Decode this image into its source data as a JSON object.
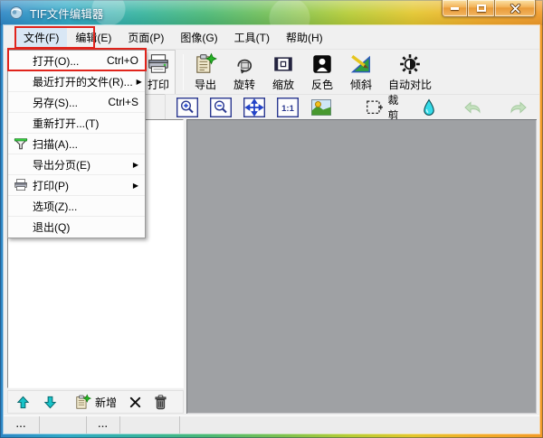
{
  "window": {
    "title": "TIF文件编辑器"
  },
  "window_controls": {
    "minimize": "minimize-icon",
    "maximize": "maximize-icon",
    "close": "close-icon"
  },
  "menubar": {
    "items": [
      {
        "label": "文件(F)",
        "annotated": true
      },
      {
        "label": "编辑(E)"
      },
      {
        "label": "页面(P)"
      },
      {
        "label": "图像(G)"
      },
      {
        "label": "工具(T)"
      },
      {
        "label": "帮助(H)"
      }
    ]
  },
  "file_menu": {
    "items": [
      {
        "label": "打开(O)...",
        "shortcut": "Ctrl+O",
        "annotated": true
      },
      {
        "label": "最近打开的文件(R)...",
        "submenu": true
      },
      {
        "label": "另存(S)...",
        "shortcut": "Ctrl+S"
      },
      {
        "label": "重新打开...(T)"
      },
      {
        "label": "扫描(A)...",
        "icon": "scanner-icon"
      },
      {
        "label": "导出分页(E)",
        "submenu": true
      },
      {
        "label": "打印(P)",
        "icon": "printer-icon",
        "submenu": true
      },
      {
        "label": "选项(Z)..."
      },
      {
        "label": "退出(Q)"
      }
    ]
  },
  "toolbar": {
    "buttons": [
      {
        "label": "打印",
        "icon": "printer-icon"
      },
      {
        "label": "导出",
        "icon": "export-icon"
      },
      {
        "label": "旋转",
        "icon": "rotate-icon"
      },
      {
        "label": "缩放",
        "icon": "resize-icon"
      },
      {
        "label": "反色",
        "icon": "invert-icon"
      },
      {
        "label": "倾斜",
        "icon": "skew-icon"
      },
      {
        "label": "自动对比",
        "icon": "auto-contrast-icon"
      }
    ]
  },
  "view_toolbar": {
    "crop_label": "裁剪",
    "one_to_one": "1:1",
    "icons": [
      "zoom-in-icon",
      "zoom-out-icon",
      "fit-page-icon",
      "actual-size-icon",
      "photo-icon",
      "selection-icon",
      "droplet-icon",
      "undo-icon",
      "redo-icon"
    ]
  },
  "page_nav": {
    "add_label": "新增",
    "icons": [
      "page-up-icon",
      "page-down-icon",
      "add-page-icon",
      "delete-icon",
      "trash-icon"
    ]
  },
  "status_bar": {
    "cell_1": "...",
    "cell_2": "..."
  },
  "glyphs": {
    "submenu_arrow": "▶"
  },
  "annotation": {
    "color": "#e0241c"
  },
  "colors": {
    "titlebar_left": "#2d86c5",
    "titlebar_right": "#f19a27",
    "canvas_gray": "#9fa1a4",
    "chrome": "#f0f0f0"
  }
}
